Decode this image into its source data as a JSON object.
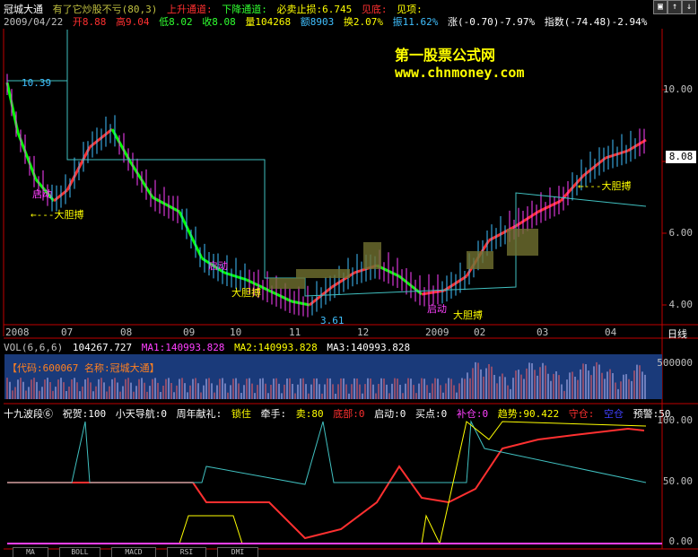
{
  "header": {
    "stock_name": "冠城大通",
    "line1_rest": "有了它炒股不亏(80,3)",
    "up_channel": "上升通道:",
    "down_channel": "下降通道:",
    "stop_loss": "必卖止损:6.745",
    "bottom": "见底:",
    "top": "见项:"
  },
  "quote": {
    "date": "2009/04/22",
    "open": "开8.88",
    "high": "高9.04",
    "low": "低8.02",
    "close": "收8.08",
    "volume": "量104268",
    "amount": "额8903",
    "turnover": "换2.07%",
    "amplitude": "振11.62%",
    "change": "涨(-0.70)-7.97%",
    "index": "指数(-74.48)-2.94%"
  },
  "watermark": {
    "line1": "第一股票公式网",
    "line2": "www.chnmoney.com"
  },
  "price_panel": {
    "y_labels": [
      "10.00",
      "8.00",
      "6.00",
      "4.00"
    ],
    "current_price": "8.08",
    "high_mark": "10.39",
    "low_mark": "3.61",
    "annotations": [
      "启动",
      "大胆搏",
      "启动",
      "大胆搏",
      "启动",
      "大胆搏",
      "大胆搏"
    ],
    "x_labels": [
      "2008",
      "07",
      "08",
      "09",
      "10",
      "11",
      "12",
      "2009",
      "02",
      "03",
      "04"
    ],
    "right_label": "日线"
  },
  "volume_panel": {
    "label": "VOL(6,6,6)",
    "vol": "104267.727",
    "ma1": "MA1:140993.828",
    "ma2": "MA2:140993.828",
    "ma3": "MA3:140993.828",
    "info": "【代码:600067 名称:冠城大通】",
    "y_label": "500000"
  },
  "indicator_panel": {
    "name": "十九波段⑥",
    "items": [
      "祝贺:100",
      "小天导航:0",
      "周年献礼:",
      "锁住",
      "牵手:",
      "卖:80",
      "底部:0",
      "启动:0",
      "买点:0",
      "补仓:0",
      "趋势:90.422",
      "守仓:",
      "空仓",
      "预警:50"
    ],
    "y_labels": [
      "100.00",
      "50.00",
      "0.00"
    ]
  },
  "tabs": [
    "MA",
    "BOLL",
    "MACD",
    "RSI",
    "DMI"
  ],
  "window_buttons": [
    "▣",
    "↑",
    "↓"
  ],
  "colors": {
    "up": "#ff3030",
    "down": "#00ff00",
    "axis": "#c00000",
    "cyan": "#40c0c0",
    "yellow": "#ffff00",
    "magenta": "#ff40ff"
  }
}
